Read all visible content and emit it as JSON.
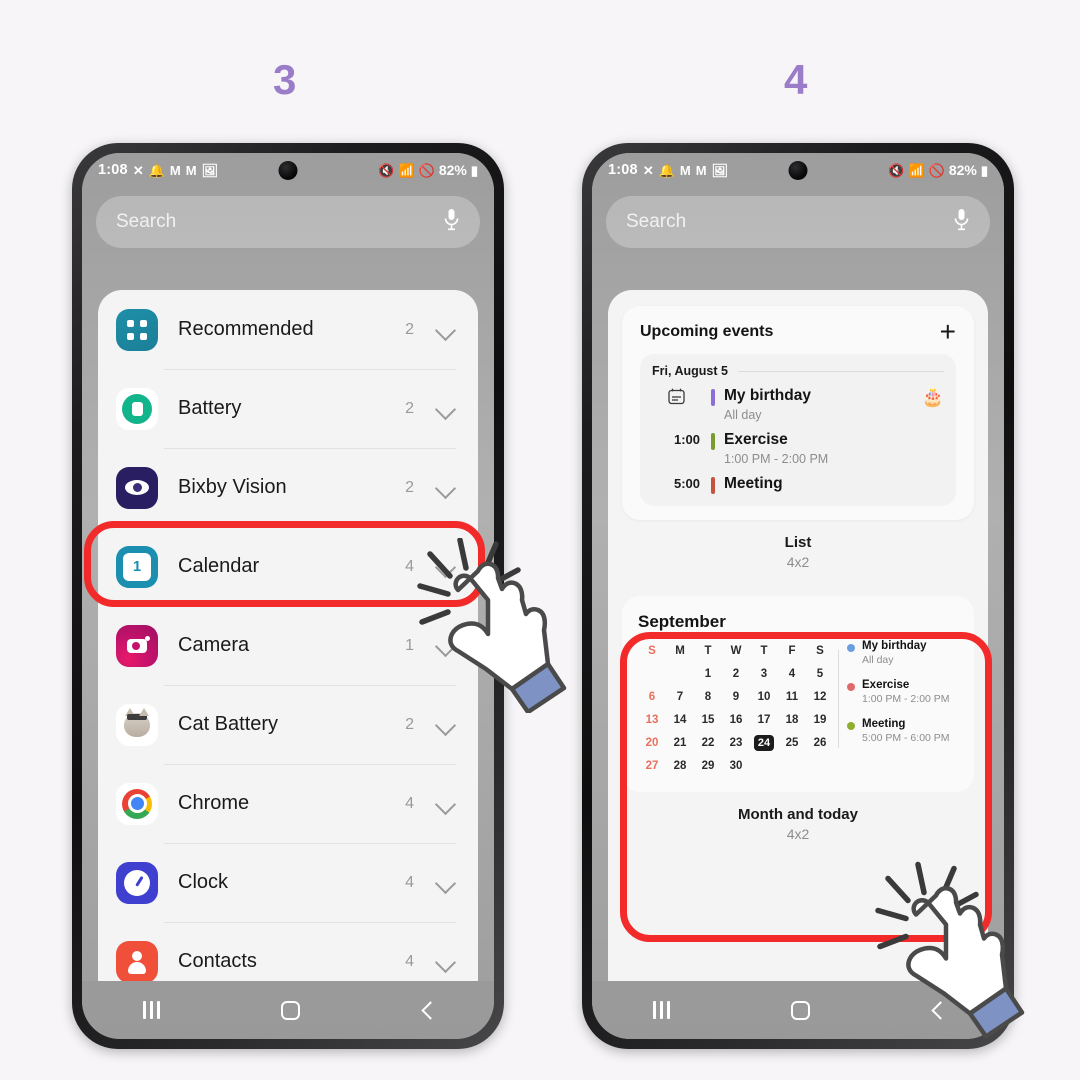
{
  "steps": [
    {
      "id": "step-3",
      "label": "3"
    },
    {
      "id": "step-4",
      "label": "4"
    }
  ],
  "colors": {
    "step_number": "#9b7cc9",
    "highlight_box": "#f32a2a",
    "page_background": "#f7f5f8",
    "today_chip": "#1c1c1c"
  },
  "status_bar": {
    "clock": "1:08",
    "left_icons": [
      "x-icon",
      "bell-icon",
      "mail-icon",
      "mail-icon",
      "image-icon"
    ],
    "right_icons": [
      "mute-icon",
      "wifi-icon",
      "dnd-icon"
    ],
    "battery_percent": "82%",
    "battery_icon": "battery-icon"
  },
  "search": {
    "placeholder": "Search",
    "mic_icon": "microphone-icon"
  },
  "nav_bar": {
    "recents": "recents-icon",
    "home": "home-icon",
    "back": "back-icon"
  },
  "left_phone": {
    "app_list": [
      {
        "name": "Recommended",
        "count": "2",
        "icon": "recommended-icon",
        "chevron": "chevron-down-icon"
      },
      {
        "name": "Battery",
        "count": "2",
        "icon": "battery-app-icon",
        "chevron": "chevron-down-icon"
      },
      {
        "name": "Bixby Vision",
        "count": "2",
        "icon": "bixby-vision-icon",
        "chevron": "chevron-down-icon"
      },
      {
        "name": "Calendar",
        "count": "4",
        "icon": "calendar-icon",
        "chevron": "chevron-down-icon",
        "highlighted": true
      },
      {
        "name": "Camera",
        "count": "1",
        "icon": "camera-icon",
        "chevron": "chevron-down-icon"
      },
      {
        "name": "Cat Battery",
        "count": "2",
        "icon": "cat-battery-icon",
        "chevron": "chevron-down-icon"
      },
      {
        "name": "Chrome",
        "count": "4",
        "icon": "chrome-icon",
        "chevron": "chevron-down-icon"
      },
      {
        "name": "Clock",
        "count": "4",
        "icon": "clock-icon",
        "chevron": "chevron-down-icon"
      },
      {
        "name": "Contacts",
        "count": "4",
        "icon": "contacts-icon",
        "chevron": "chevron-down-icon"
      }
    ],
    "calendar_icon_day": "1"
  },
  "right_phone": {
    "list_widget": {
      "title": "Upcoming events",
      "add_icon": "plus-icon",
      "date_header": "Fri, August 5",
      "events": [
        {
          "time": "",
          "calendar_icon": "calendar-outline-icon",
          "title": "My birthday",
          "sub": "All day",
          "bar_color": "#8b6fd4",
          "emoji": "🎂"
        },
        {
          "time": "1:00",
          "title": "Exercise",
          "sub": "1:00 PM - 2:00 PM",
          "bar_color": "#7a9c2f",
          "emoji": ""
        },
        {
          "time": "5:00",
          "title": "Meeting",
          "sub": "",
          "bar_color": "#c4543b",
          "emoji": ""
        }
      ],
      "label": "List",
      "size": "4x2"
    },
    "month_widget": {
      "month": "September",
      "weekday_headers": [
        "S",
        "M",
        "T",
        "W",
        "T",
        "F",
        "S"
      ],
      "weeks": [
        [
          "",
          "",
          "1",
          "2",
          "3",
          "4",
          "5"
        ],
        [
          "6",
          "7",
          "8",
          "9",
          "10",
          "11",
          "12"
        ],
        [
          "13",
          "14",
          "15",
          "16",
          "17",
          "18",
          "19"
        ],
        [
          "20",
          "21",
          "22",
          "23",
          "24",
          "25",
          "26"
        ],
        [
          "27",
          "28",
          "29",
          "30",
          "",
          "",
          ""
        ]
      ],
      "today": "24",
      "events": [
        {
          "title": "My birthday",
          "sub": "All day",
          "dot_color": "#6a9fe0"
        },
        {
          "title": "Exercise",
          "sub": "1:00 PM - 2:00 PM",
          "dot_color": "#e06a6a"
        },
        {
          "title": "Meeting",
          "sub": "5:00 PM - 6:00 PM",
          "dot_color": "#8fae2f"
        }
      ],
      "label": "Month and today",
      "size": "4x2"
    }
  },
  "cursors": [
    {
      "name": "pointing-hand-cursor-left"
    },
    {
      "name": "pointing-hand-cursor-right"
    }
  ]
}
